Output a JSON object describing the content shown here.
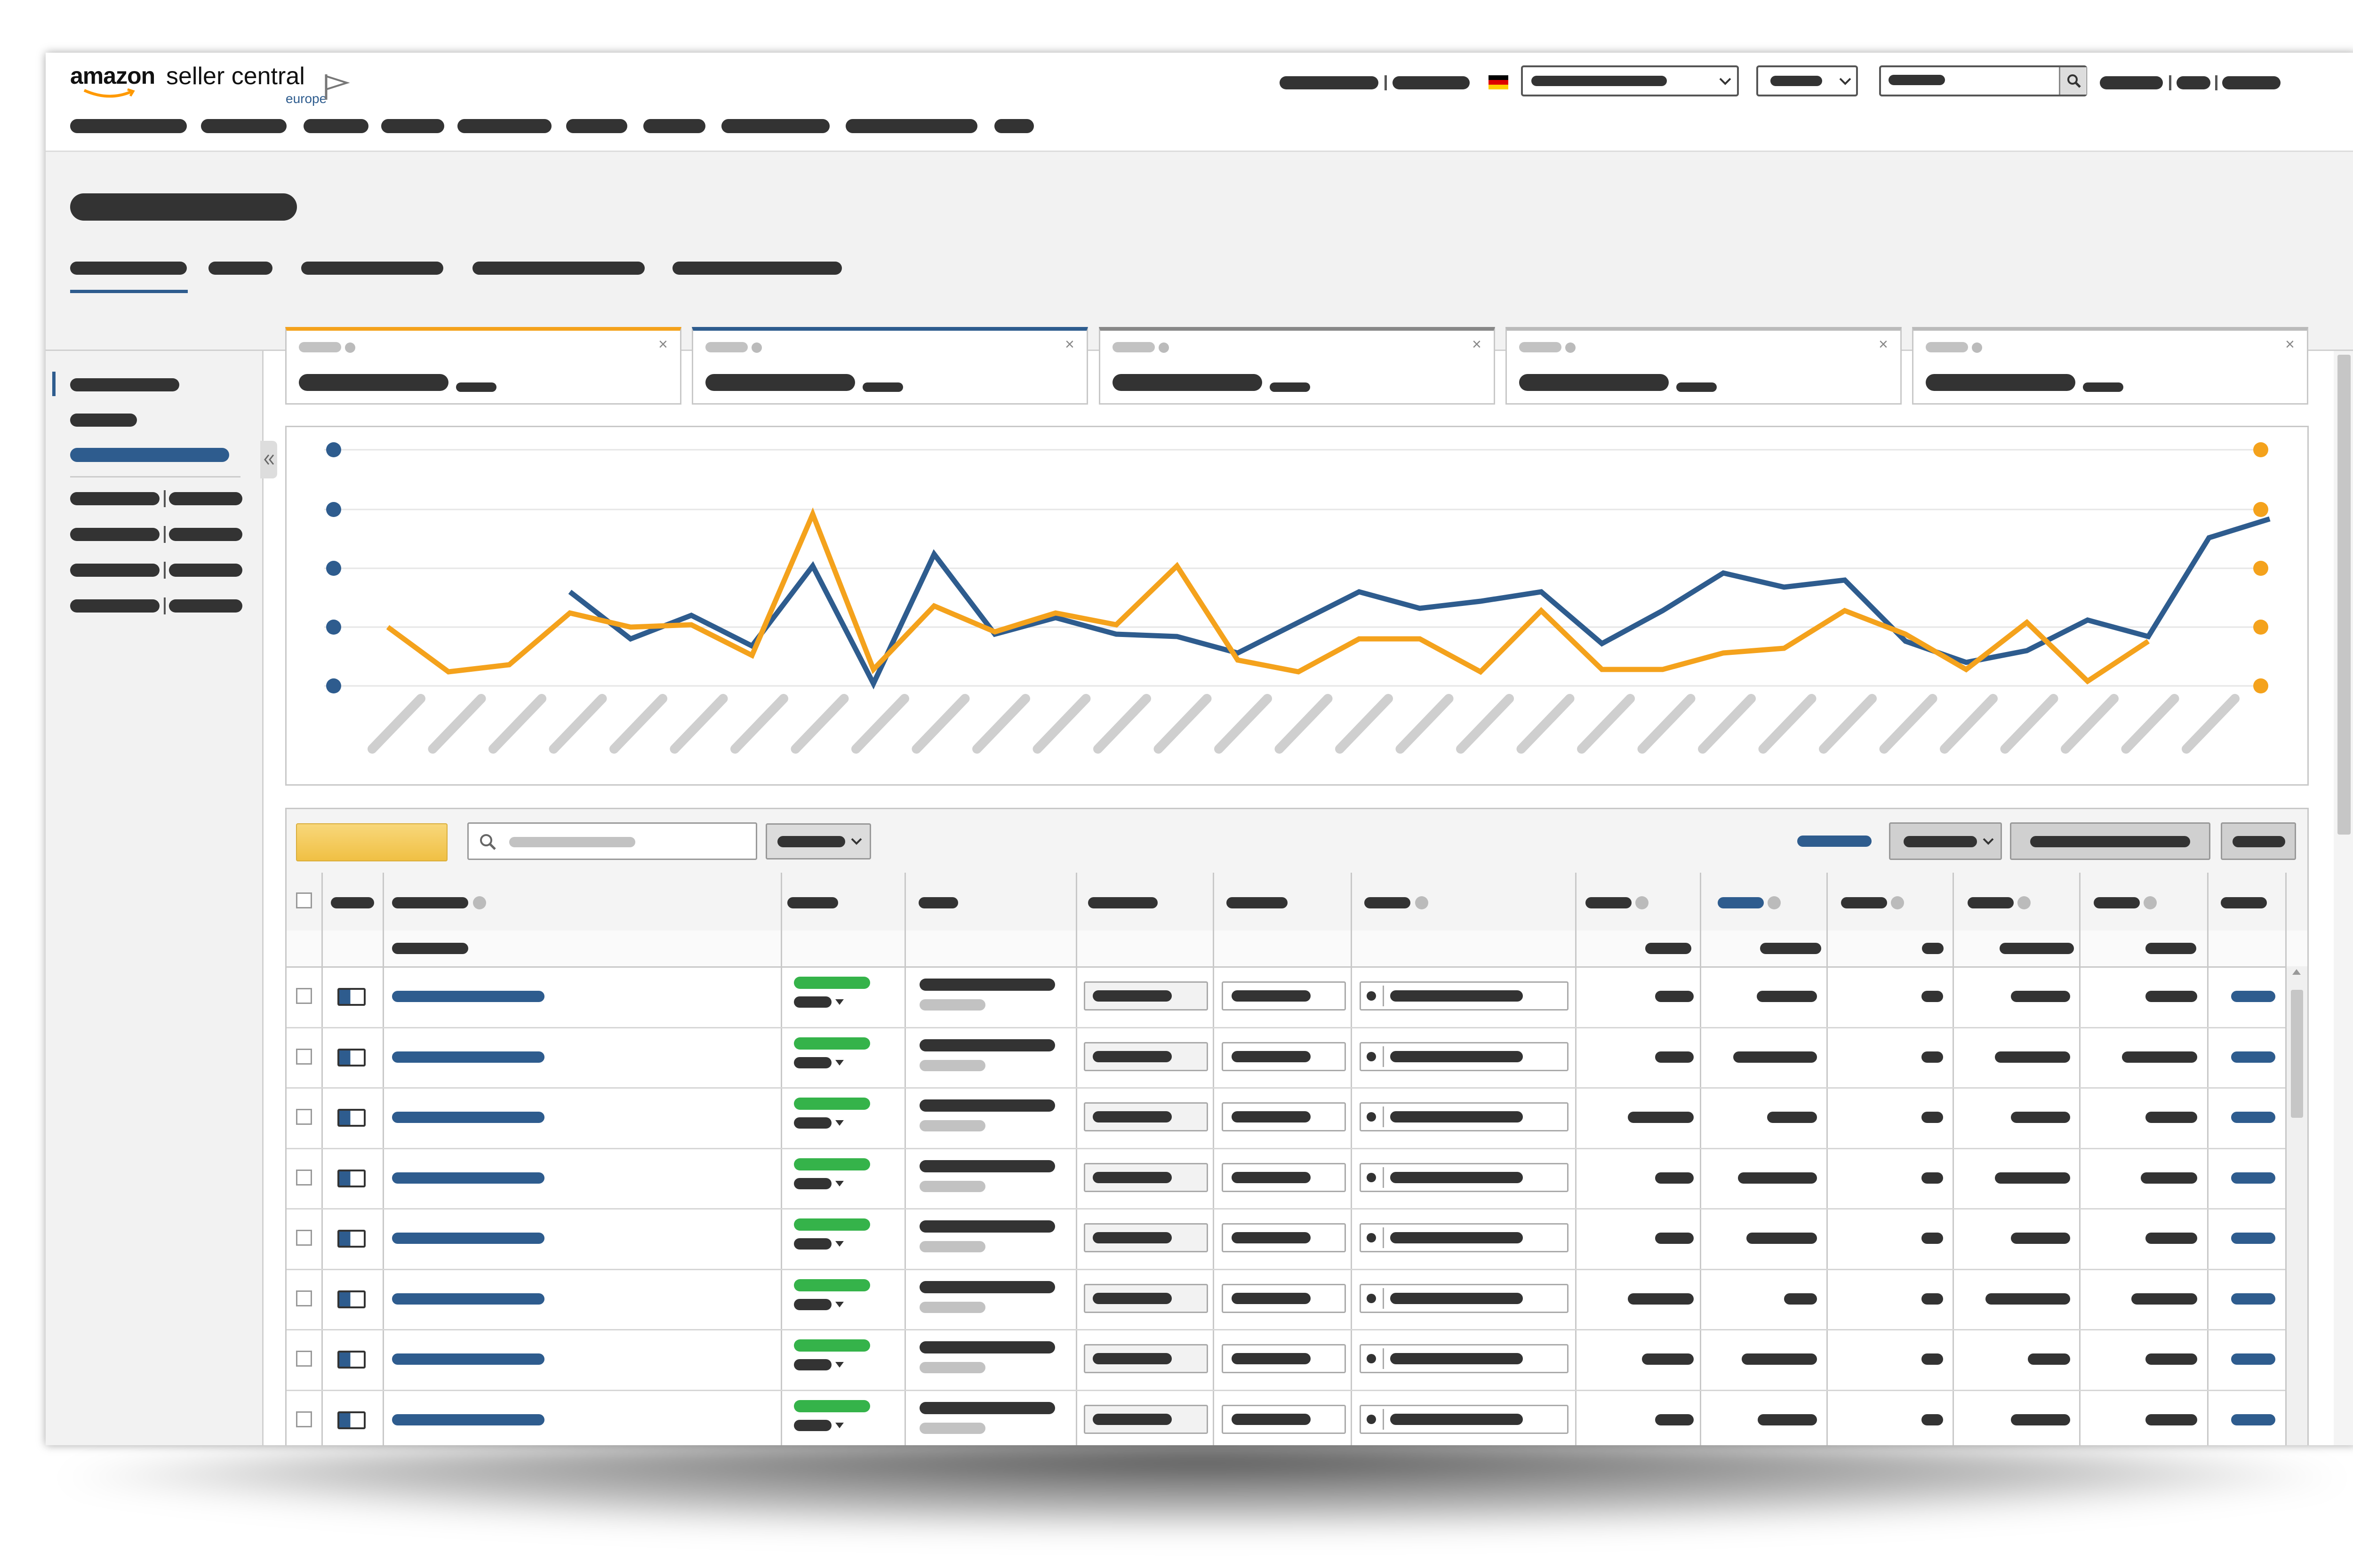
{
  "brand": {
    "logo_text": "amazon",
    "product": "seller central",
    "region": "europe",
    "accent": "#ff9900",
    "primary": "#2e5c8e"
  },
  "colors": {
    "series_blue": "#2e5c8e",
    "series_orange": "#f4a21c",
    "placeholder_dark": "#333333",
    "placeholder_light": "#c2c2c2",
    "status_green": "#35b34a"
  },
  "icons": {
    "flag": "flag-icon",
    "country": "germany-flag-icon",
    "search": "search-icon",
    "collapse": "collapse-sidebar-icon",
    "close": "close-icon",
    "chevron": "chevron-down-icon"
  },
  "chart_data": {
    "type": "line",
    "series": [
      {
        "color": "#2e5c8e",
        "values": [
          null,
          null,
          null,
          42,
          22,
          32,
          19,
          53,
          3,
          58,
          24,
          31,
          24,
          23,
          16,
          29,
          42,
          35,
          38,
          42,
          20,
          34,
          50,
          44,
          47,
          21,
          12,
          17,
          30,
          23,
          65,
          73
        ]
      },
      {
        "color": "#f4a21c",
        "values": [
          27,
          8,
          11,
          33,
          27,
          28,
          15,
          75,
          9,
          36,
          25,
          33,
          28,
          53,
          13,
          8,
          22,
          22,
          8,
          34,
          9,
          9,
          16,
          18,
          34,
          24,
          9,
          29,
          4,
          21
        ]
      }
    ]
  }
}
